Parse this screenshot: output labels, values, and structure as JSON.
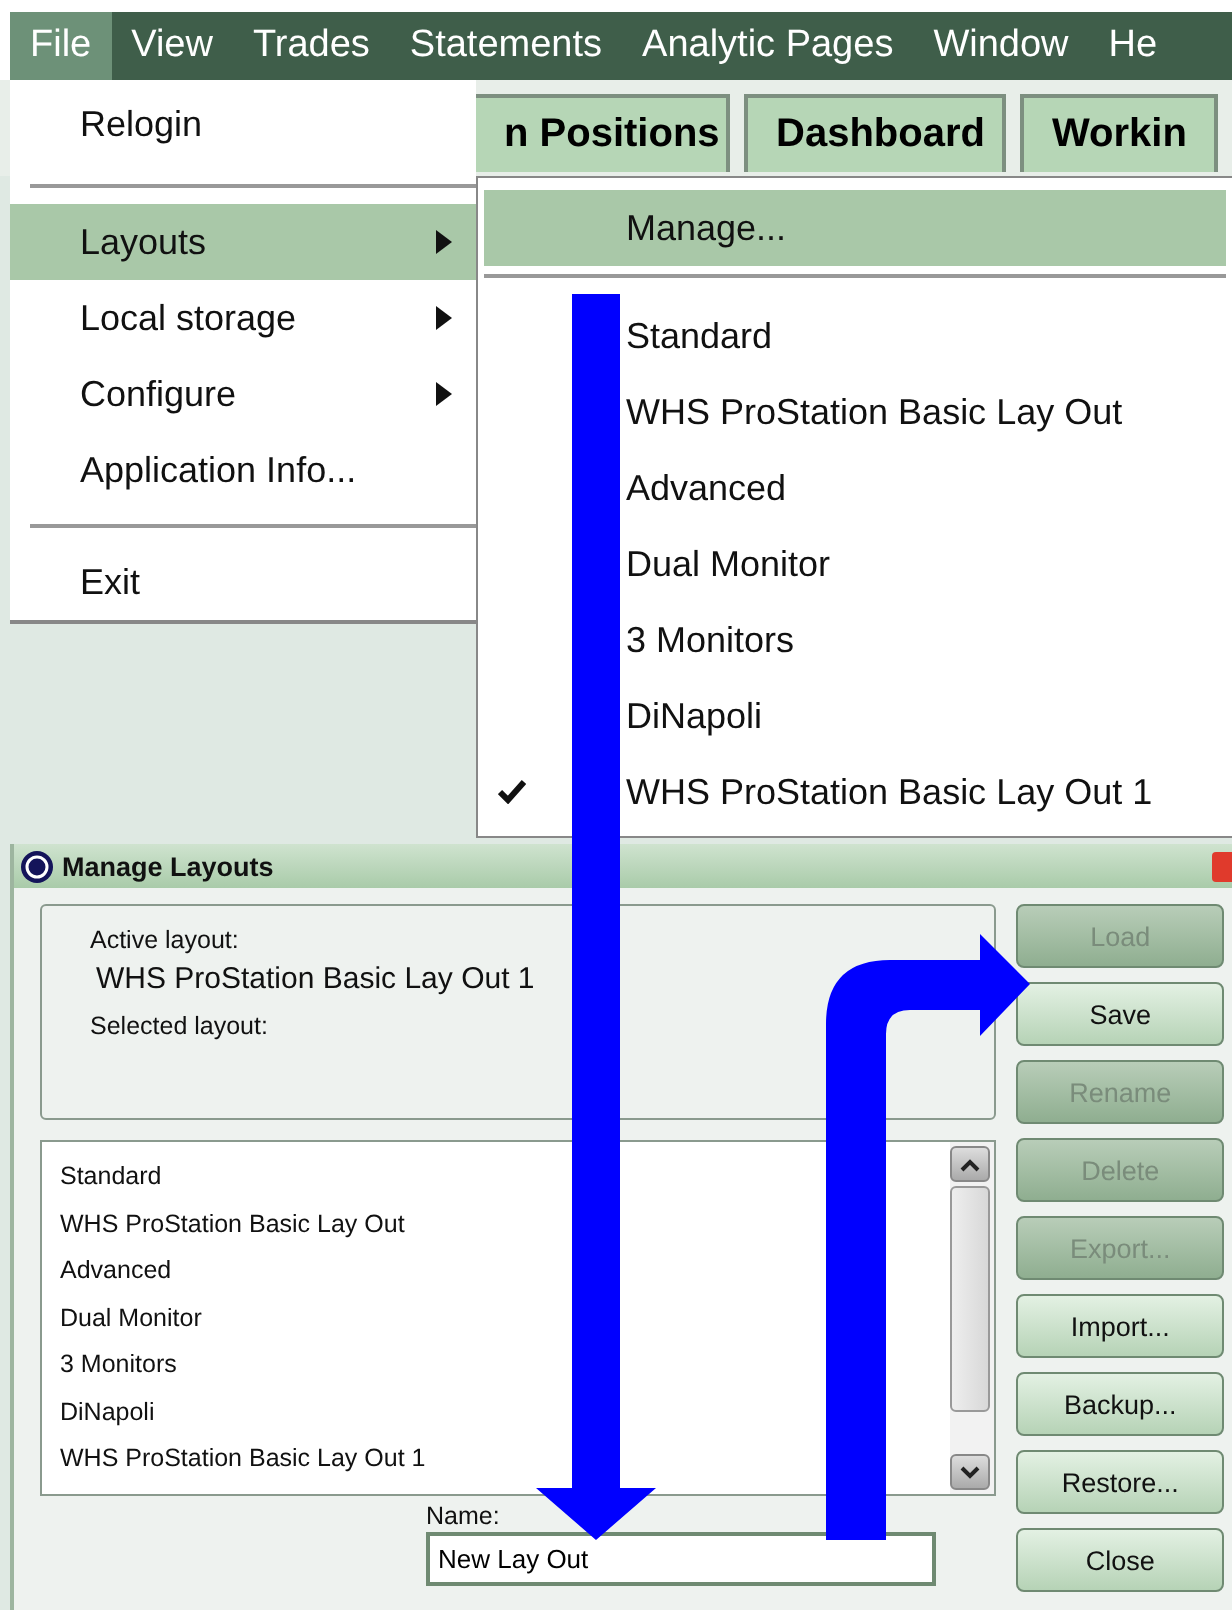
{
  "menubar": [
    {
      "label": "File",
      "selected": true
    },
    {
      "label": "View",
      "selected": false
    },
    {
      "label": "Trades",
      "selected": false
    },
    {
      "label": "Statements",
      "selected": false
    },
    {
      "label": "Analytic Pages",
      "selected": false
    },
    {
      "label": "Window",
      "selected": false
    },
    {
      "label": "He",
      "selected": false
    }
  ],
  "tabs": [
    {
      "label": "n Positions"
    },
    {
      "label": "Dashboard"
    },
    {
      "label": "Workin"
    }
  ],
  "file_menu": [
    {
      "kind": "item",
      "label": "Relogin",
      "selected": false,
      "has_submenu": false
    },
    {
      "kind": "separator"
    },
    {
      "kind": "item",
      "label": "Layouts",
      "selected": true,
      "has_submenu": true
    },
    {
      "kind": "item",
      "label": "Local storage",
      "selected": false,
      "has_submenu": true
    },
    {
      "kind": "item",
      "label": "Configure",
      "selected": false,
      "has_submenu": true
    },
    {
      "kind": "item",
      "label": "Application Info...",
      "selected": false,
      "has_submenu": false
    },
    {
      "kind": "separator"
    },
    {
      "kind": "item",
      "label": "Exit",
      "selected": false,
      "has_submenu": false
    }
  ],
  "layouts_submenu": [
    {
      "kind": "item",
      "label": "Manage...",
      "selected": true,
      "checked": false
    },
    {
      "kind": "separator"
    },
    {
      "kind": "item",
      "label": "Standard",
      "selected": false,
      "checked": false
    },
    {
      "kind": "item",
      "label": "WHS ProStation Basic Lay Out",
      "selected": false,
      "checked": false
    },
    {
      "kind": "item",
      "label": "Advanced",
      "selected": false,
      "checked": false
    },
    {
      "kind": "item",
      "label": "Dual Monitor",
      "selected": false,
      "checked": false
    },
    {
      "kind": "item",
      "label": "3 Monitors",
      "selected": false,
      "checked": false
    },
    {
      "kind": "item",
      "label": "DiNapoli",
      "selected": false,
      "checked": false
    },
    {
      "kind": "item",
      "label": "WHS ProStation Basic Lay Out 1",
      "selected": false,
      "checked": true
    }
  ],
  "dialog": {
    "title": "Manage Layouts",
    "active_label": "Active layout:",
    "active_value": "WHS ProStation Basic Lay Out 1",
    "selected_label": "Selected layout:",
    "layouts": [
      "Standard",
      "WHS ProStation Basic Lay Out",
      "Advanced",
      "Dual Monitor",
      "3 Monitors",
      "DiNapoli",
      "WHS ProStation Basic Lay Out 1"
    ],
    "name_label": "Name:",
    "name_value": "New Lay Out",
    "buttons": [
      {
        "label": "Load",
        "disabled": true
      },
      {
        "label": "Save",
        "disabled": false
      },
      {
        "label": "Rename",
        "disabled": true
      },
      {
        "label": "Delete",
        "disabled": true
      },
      {
        "label": "Export...",
        "disabled": true
      },
      {
        "label": "Import...",
        "disabled": false
      },
      {
        "label": "Backup...",
        "disabled": false
      },
      {
        "label": "Restore...",
        "disabled": false
      },
      {
        "label": "Close",
        "disabled": false
      }
    ]
  }
}
